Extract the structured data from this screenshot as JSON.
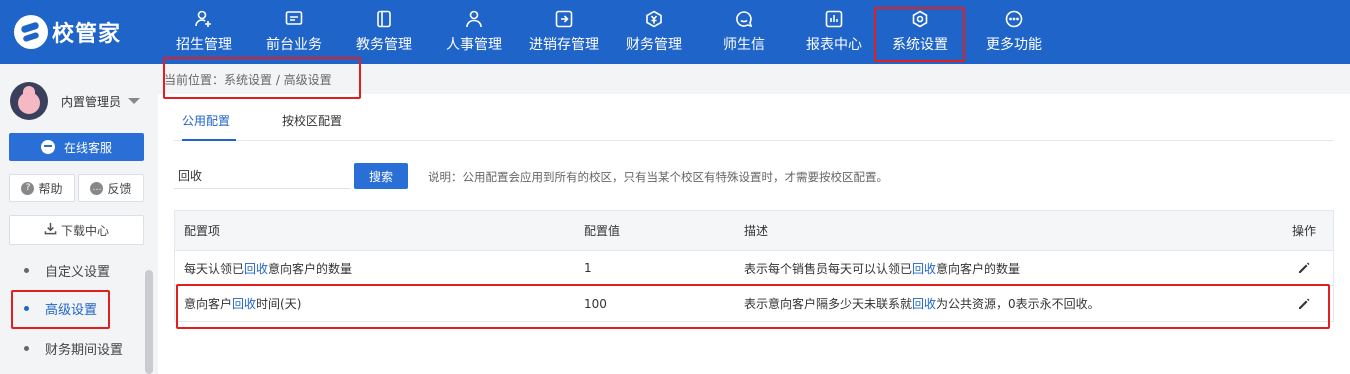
{
  "app": {
    "logo_text": "校管家"
  },
  "nav": [
    {
      "label": "招生管理",
      "icon": "user-add-icon"
    },
    {
      "label": "前台业务",
      "icon": "monitor-icon"
    },
    {
      "label": "教务管理",
      "icon": "book-icon"
    },
    {
      "label": "人事管理",
      "icon": "person-icon"
    },
    {
      "label": "进销存管理",
      "icon": "inventory-icon"
    },
    {
      "label": "财务管理",
      "icon": "finance-icon"
    },
    {
      "label": "师生信",
      "icon": "message-icon"
    },
    {
      "label": "报表中心",
      "icon": "report-icon"
    },
    {
      "label": "系统设置",
      "icon": "settings-icon",
      "active": true
    },
    {
      "label": "更多功能",
      "icon": "more-icon"
    }
  ],
  "sidebar": {
    "user_name": "内置管理员",
    "service_button": "在线客服",
    "help_button": "帮助",
    "feedback_button": "反馈",
    "download_button": "下载中心",
    "menu": [
      {
        "label": "自定义设置",
        "active": false
      },
      {
        "label": "高级设置",
        "active": true
      },
      {
        "label": "财务期间设置",
        "active": false
      }
    ]
  },
  "breadcrumb": "当前位置：系统设置 / 高级设置",
  "tabs": [
    {
      "label": "公用配置",
      "active": true
    },
    {
      "label": "按校区配置",
      "active": false
    }
  ],
  "search": {
    "value": "回收",
    "button": "搜索",
    "note": "说明：公用配置会应用到所有的校区，只有当某个校区有特殊设置时，才需要按校区配置。"
  },
  "table": {
    "headers": [
      "配置项",
      "配置值",
      "描述",
      "操作"
    ],
    "rows": [
      {
        "item_pre": "每天认领已",
        "item_hl": "回收",
        "item_post": "意向客户的数量",
        "value": "1",
        "desc_pre": "表示每个销售员每天可以认领已",
        "desc_hl": "回收",
        "desc_post": "意向客户的数量"
      },
      {
        "item_pre": "意向客户",
        "item_hl": "回收",
        "item_post": "时间(天)",
        "value": "100",
        "desc_pre": "表示意向客户隔多少天未联系就",
        "desc_hl": "回收",
        "desc_post": "为公共资源，0表示永不回收。"
      }
    ]
  },
  "colors": {
    "nav_bg": "#1f64c8",
    "primary": "#2a6fd6",
    "highlight_box": "#e02020"
  }
}
